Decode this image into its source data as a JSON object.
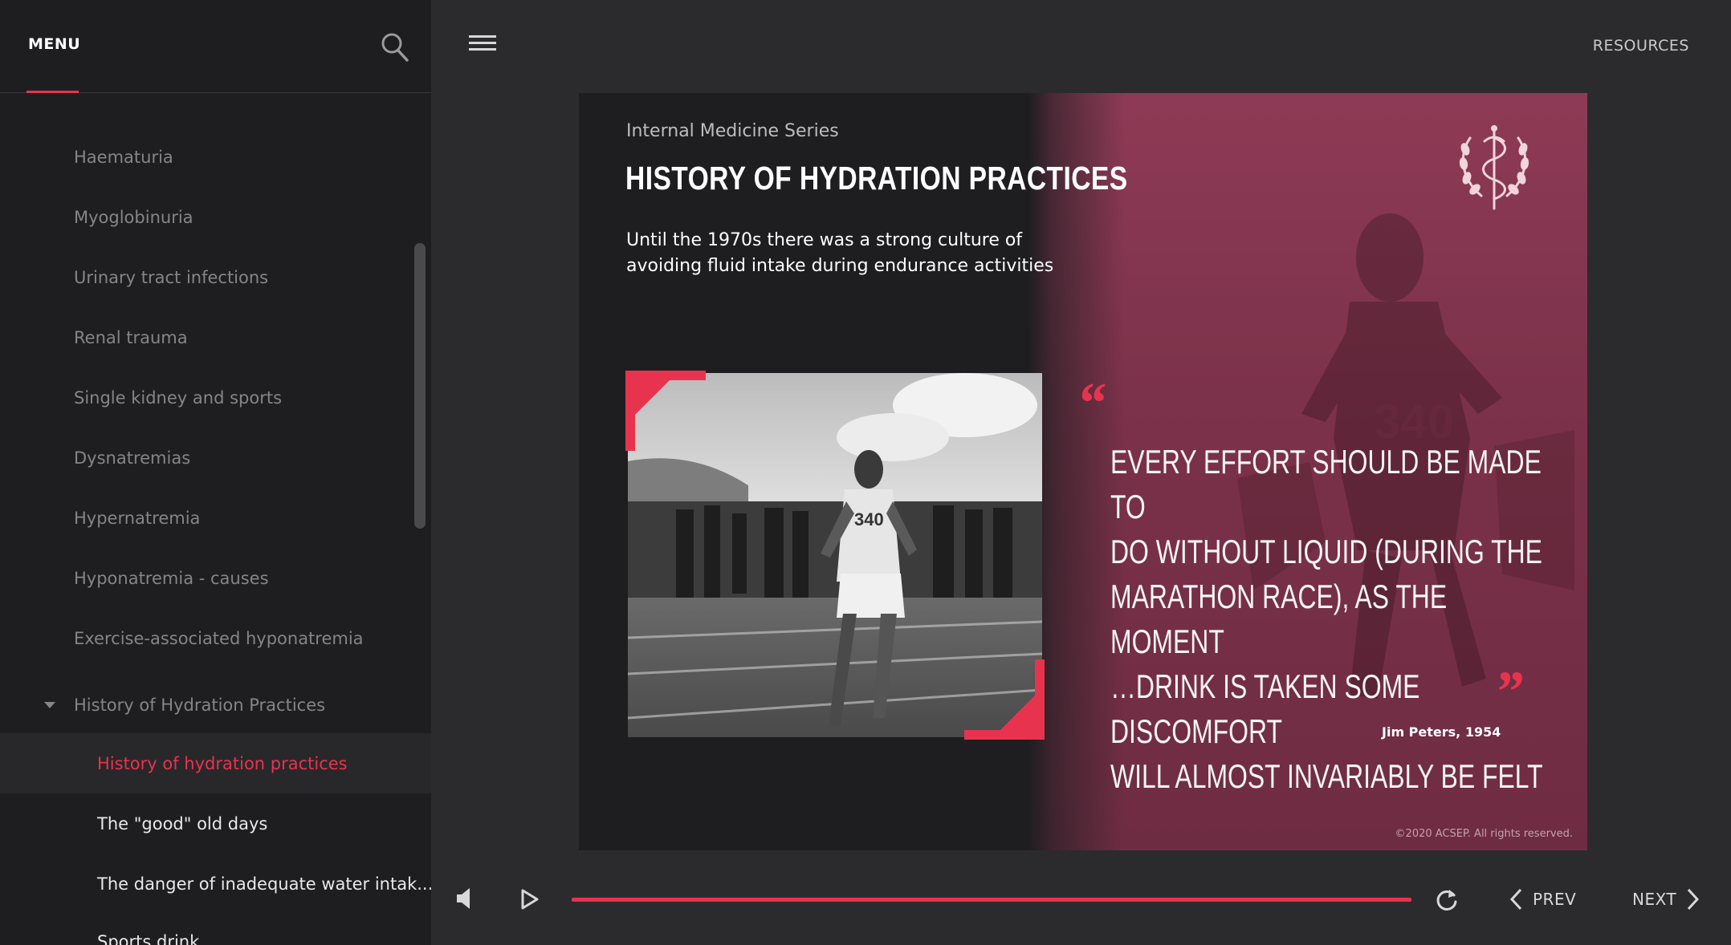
{
  "sidebar": {
    "menu_label": "MENU",
    "items": [
      {
        "label": "Haematuria"
      },
      {
        "label": "Myoglobinuria"
      },
      {
        "label": "Urinary tract infections"
      },
      {
        "label": "Renal trauma"
      },
      {
        "label": "Single kidney and sports"
      },
      {
        "label": "Dysnatremias"
      },
      {
        "label": "Hypernatremia"
      },
      {
        "label": "Hyponatremia - causes"
      },
      {
        "label": "Exercise-associated hyponatremia"
      },
      {
        "label": "History of Hydration Practices"
      }
    ],
    "subitems": [
      {
        "label": "History of hydration practices"
      },
      {
        "label": "The \"good\" old days"
      },
      {
        "label": "The danger of inadequate water intak..."
      },
      {
        "label": "Sports drink"
      }
    ]
  },
  "header": {
    "resources_label": "RESOURCES"
  },
  "slide": {
    "series": "Internal Medicine Series",
    "title": "HISTORY OF HYDRATION PRACTICES",
    "intro_line1": "Until the 1970s there was a strong culture of",
    "intro_line2": "avoiding fluid intake during endurance activities",
    "quote_open": "“",
    "quote_close": "”",
    "quote_lines": [
      "EVERY EFFORT SHOULD BE MADE TO",
      "DO WITHOUT LIQUID (DURING THE",
      "MARATHON RACE), AS THE MOMENT",
      "…DRINK IS TAKEN SOME DISCOMFORT",
      "WILL ALMOST INVARIABLY BE FELT"
    ],
    "author": "Jim Peters, 1954",
    "copyright": "©2020 ACSEP. All rights reserved."
  },
  "player": {
    "prev_label": "PREV",
    "next_label": "NEXT",
    "progress": 1.0
  },
  "colors": {
    "accent": "#e8334f",
    "sidebar_bg": "#1e1e20",
    "main_bg": "#2b2b2d"
  }
}
